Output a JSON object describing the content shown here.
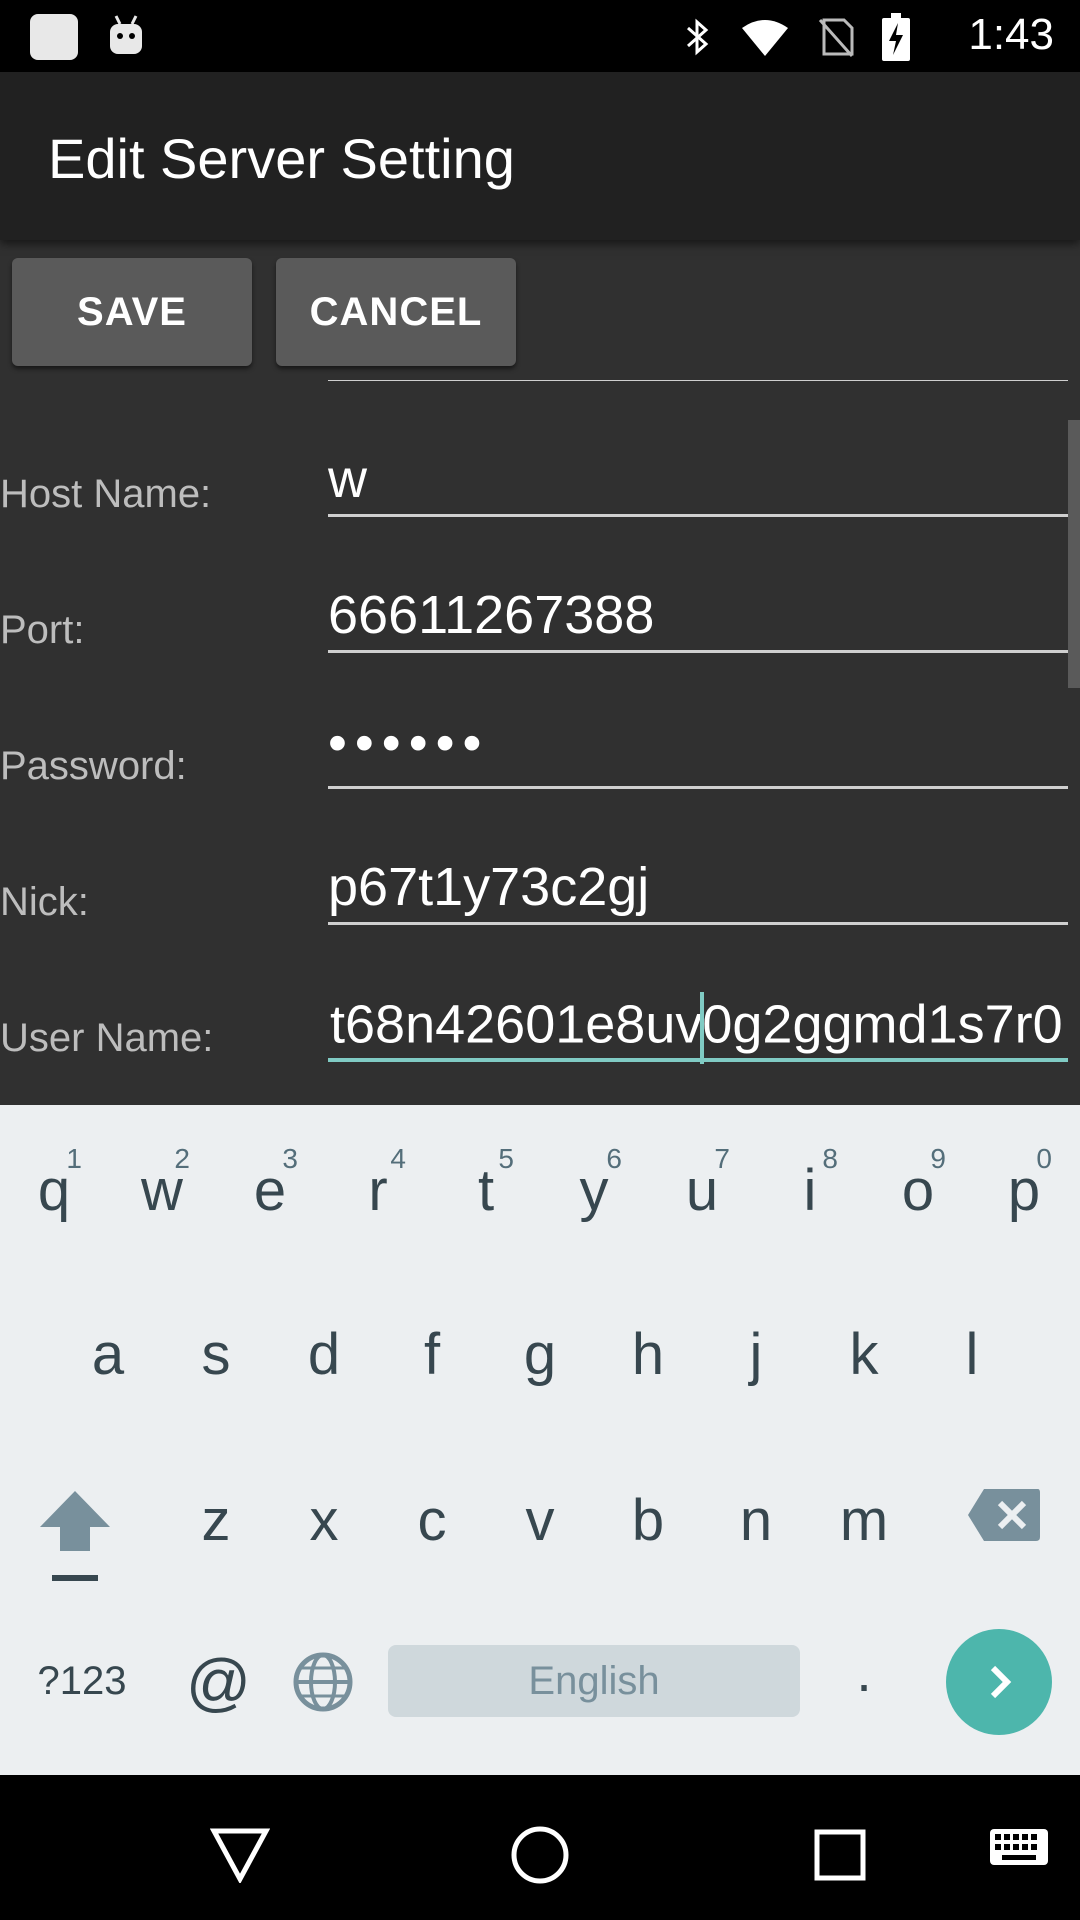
{
  "status_bar": {
    "time": "1:43",
    "icons": [
      "bluetooth-icon",
      "wifi-icon",
      "no-sim-icon",
      "battery-charging-icon"
    ]
  },
  "app_bar": {
    "title": "Edit Server Setting"
  },
  "actions": {
    "save_label": "SAVE",
    "cancel_label": "CANCEL"
  },
  "form": {
    "fields": [
      {
        "label": "Host Name:",
        "value": "w"
      },
      {
        "label": "Port:",
        "value": "66611267388"
      },
      {
        "label": "Password:",
        "value": "••••••"
      },
      {
        "label": "Nick:",
        "value": "p67t1y73c2gj"
      },
      {
        "label": "User Name:",
        "value_before_cursor": "t68n42601e8uv",
        "value_after_cursor": "0g2ggmd1s7r0"
      }
    ]
  },
  "keyboard": {
    "row1": [
      {
        "ch": "q",
        "num": "1"
      },
      {
        "ch": "w",
        "num": "2"
      },
      {
        "ch": "e",
        "num": "3"
      },
      {
        "ch": "r",
        "num": "4"
      },
      {
        "ch": "t",
        "num": "5"
      },
      {
        "ch": "y",
        "num": "6"
      },
      {
        "ch": "u",
        "num": "7"
      },
      {
        "ch": "i",
        "num": "8"
      },
      {
        "ch": "o",
        "num": "9"
      },
      {
        "ch": "p",
        "num": "0"
      }
    ],
    "row2": [
      "a",
      "s",
      "d",
      "f",
      "g",
      "h",
      "j",
      "k",
      "l"
    ],
    "row3": [
      "z",
      "x",
      "c",
      "v",
      "b",
      "n",
      "m"
    ],
    "symbols_label": "?123",
    "at_label": "@",
    "space_label": "English",
    "period_label": ".",
    "accent_color": "#4db6ac"
  }
}
